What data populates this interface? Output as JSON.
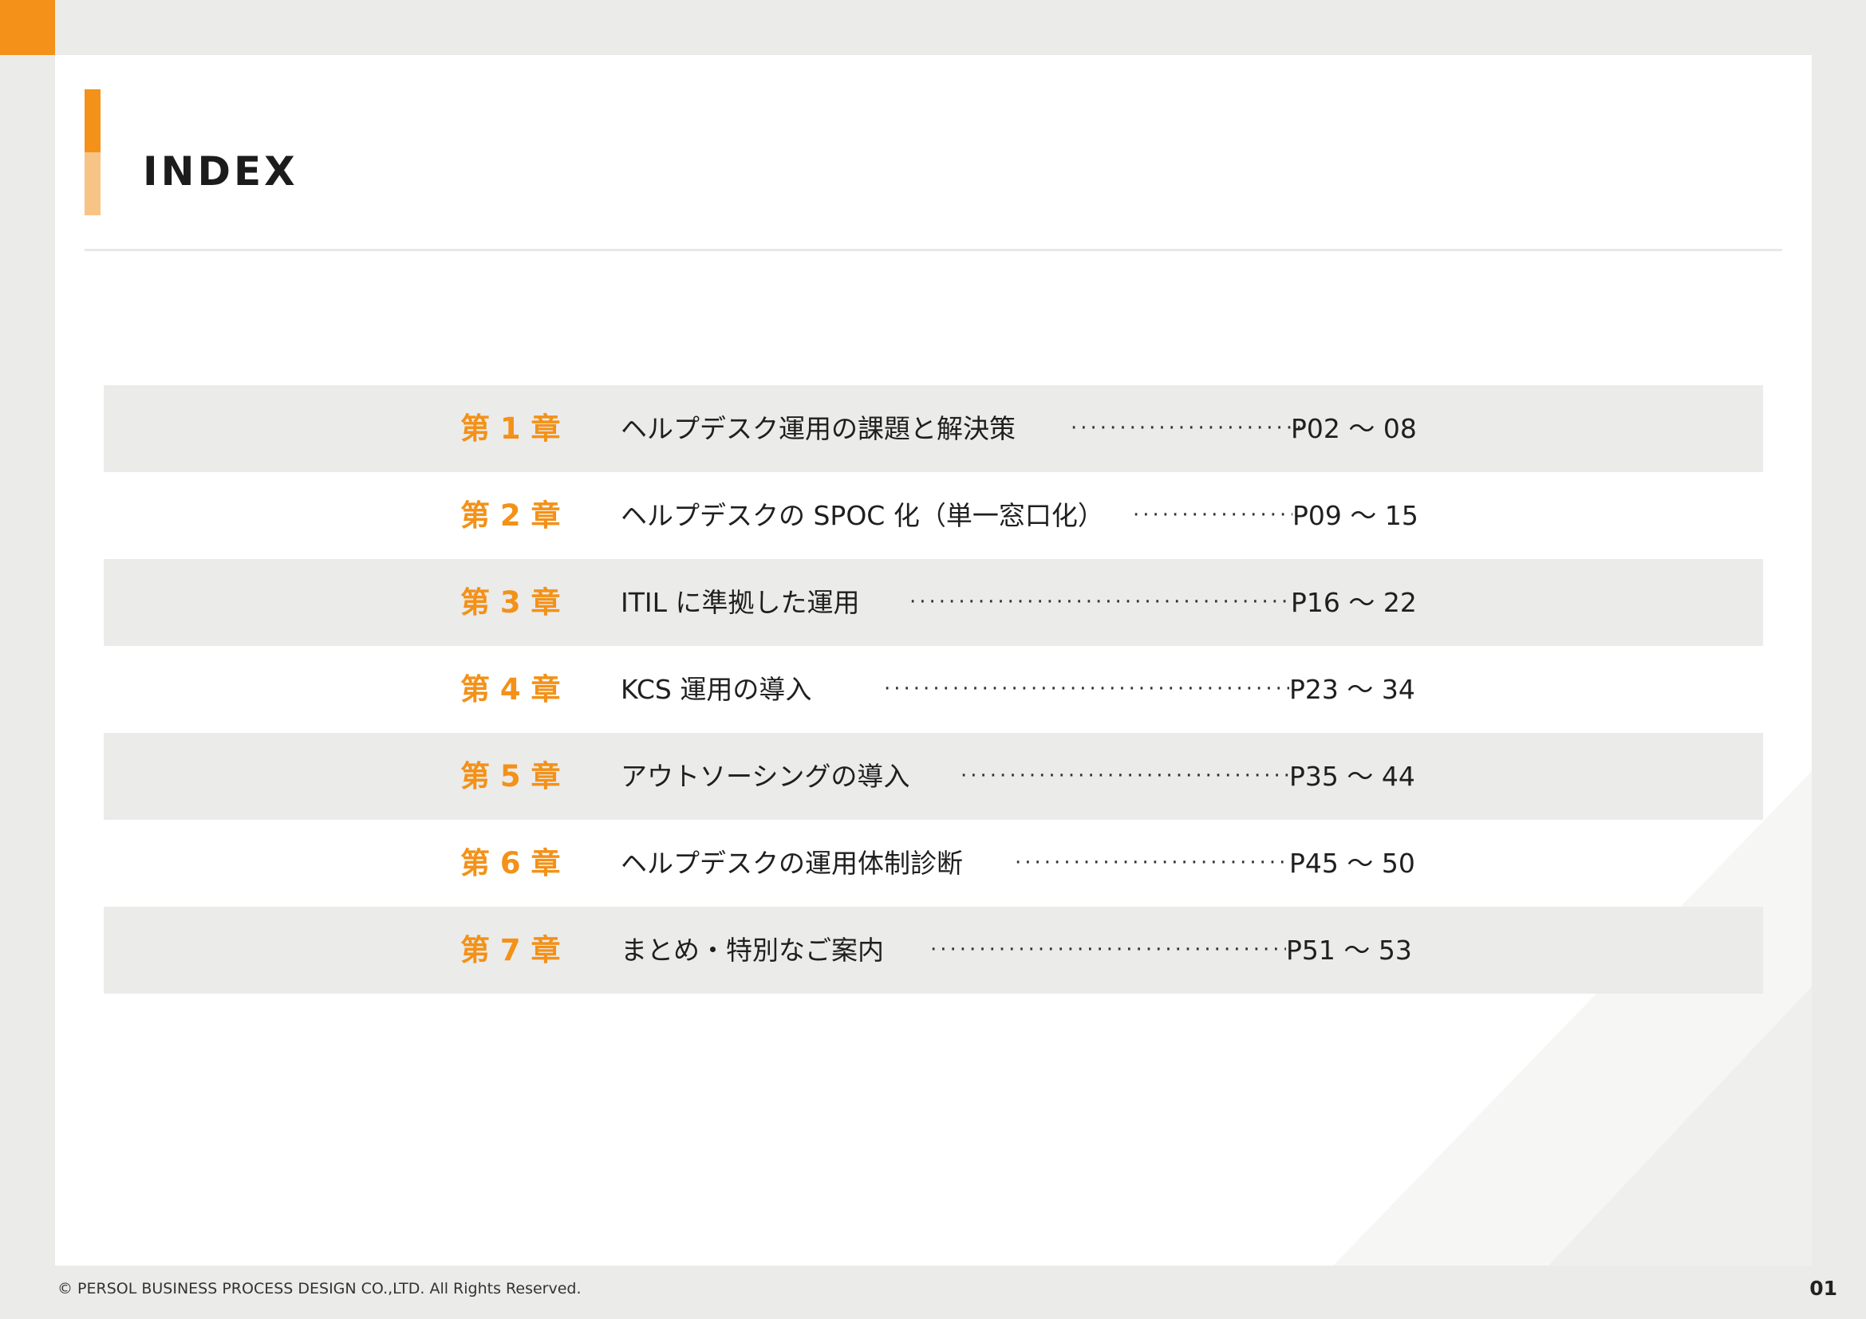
{
  "header": {
    "title": "INDEX"
  },
  "toc": [
    {
      "chapter": "第 1 章",
      "title": "ヘルプデスク運用の課題と解決策",
      "pages": "P02 ～ 08"
    },
    {
      "chapter": "第 2 章",
      "title": "ヘルプデスクの SPOC 化（単一窓口化）",
      "pages": "P09 ～ 15"
    },
    {
      "chapter": "第 3 章",
      "title": "ITIL に準拠した運用",
      "pages": "P16 ～ 22"
    },
    {
      "chapter": "第 4 章",
      "title": "KCS 運用の導入",
      "pages": "P23 ～ 34"
    },
    {
      "chapter": "第 5 章",
      "title": "アウトソーシングの導入",
      "pages": "P35 ～ 44"
    },
    {
      "chapter": "第 6 章",
      "title": "ヘルプデスクの運用体制診断",
      "pages": "P45 ～ 50"
    },
    {
      "chapter": "第 7 章",
      "title": "まとめ・特別なご案内",
      "pages": "P51 ～ 53"
    }
  ],
  "footer": {
    "copyright": "© PERSOL BUSINESS PROCESS DESIGN CO.,LTD. All Rights Reserved.",
    "page_number": "01"
  },
  "colors": {
    "accent": "#f39118",
    "accent_light": "#f8c485",
    "row_shade": "#ebebea"
  }
}
